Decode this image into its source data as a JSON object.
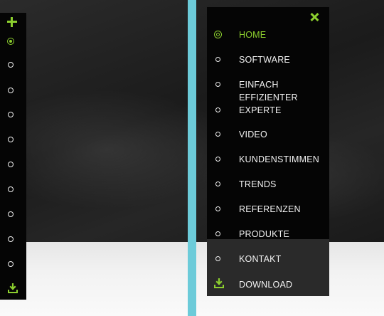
{
  "colors": {
    "accent": "#8ccf2e",
    "panel_bg": "#050505",
    "divider": "#6ccbd9",
    "text": "#f2f2f2"
  },
  "mini_rail": {
    "expand_icon": "plus-icon",
    "download_icon": "download-icon",
    "active_index": 0,
    "dot_count": 10
  },
  "menu": {
    "close_icon": "close-icon",
    "items": [
      {
        "label": "HOME",
        "active": true
      },
      {
        "label": "SOFTWARE",
        "active": false
      },
      {
        "label": "EINFACH\nEFFIZIENTER\nEXPERTE",
        "active": false
      },
      {
        "label": "VIDEO",
        "active": false
      },
      {
        "label": "KUNDENSTIMMEN",
        "active": false
      },
      {
        "label": "TRENDS",
        "active": false
      },
      {
        "label": "REFERENZEN",
        "active": false
      },
      {
        "label": "PRODUKTE",
        "active": false
      },
      {
        "label": "KONTAKT",
        "active": false
      }
    ],
    "download": {
      "label": "DOWNLOAD",
      "icon": "download-icon"
    }
  }
}
